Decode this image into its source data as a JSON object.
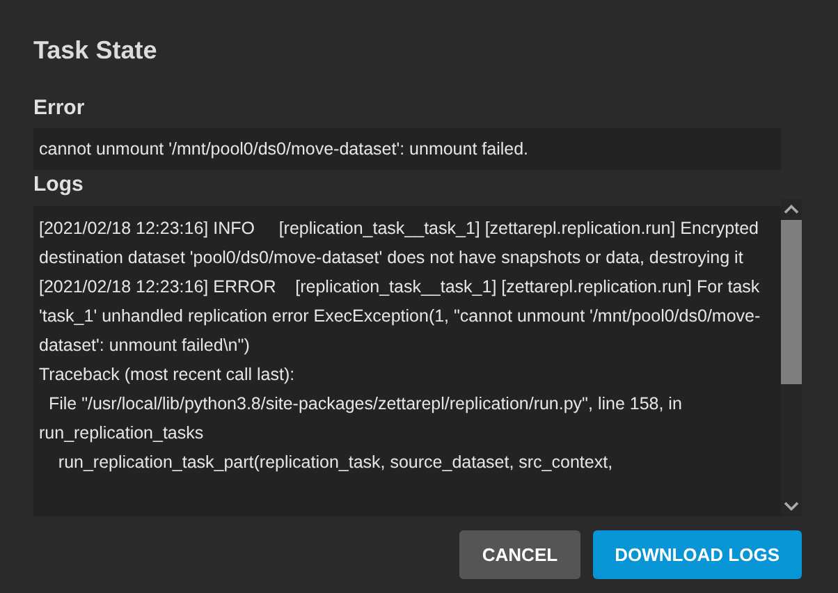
{
  "dialog": {
    "title": "Task State"
  },
  "error": {
    "label": "Error",
    "message": "cannot unmount '/mnt/pool0/ds0/move-dataset': unmount failed."
  },
  "logs": {
    "label": "Logs",
    "lines": [
      "[2021/02/18 12:23:16] INFO     [replication_task__task_1] [zettarepl.replication.run] Encrypted destination dataset 'pool0/ds0/move-dataset' does not have snapshots or data, destroying it",
      "[2021/02/18 12:23:16] ERROR    [replication_task__task_1] [zettarepl.replication.run] For task 'task_1' unhandled replication error ExecException(1, \"cannot unmount '/mnt/pool0/ds0/move-dataset': unmount failed\\n\")",
      "Traceback (most recent call last):",
      "  File \"/usr/local/lib/python3.8/site-packages/zettarepl/replication/run.py\", line 158, in run_replication_tasks",
      "    run_replication_task_part(replication_task, source_dataset, src_context,"
    ]
  },
  "buttons": [
    {
      "label": "CANCEL",
      "kind": "secondary"
    },
    {
      "label": "DOWNLOAD LOGS",
      "kind": "primary"
    }
  ]
}
